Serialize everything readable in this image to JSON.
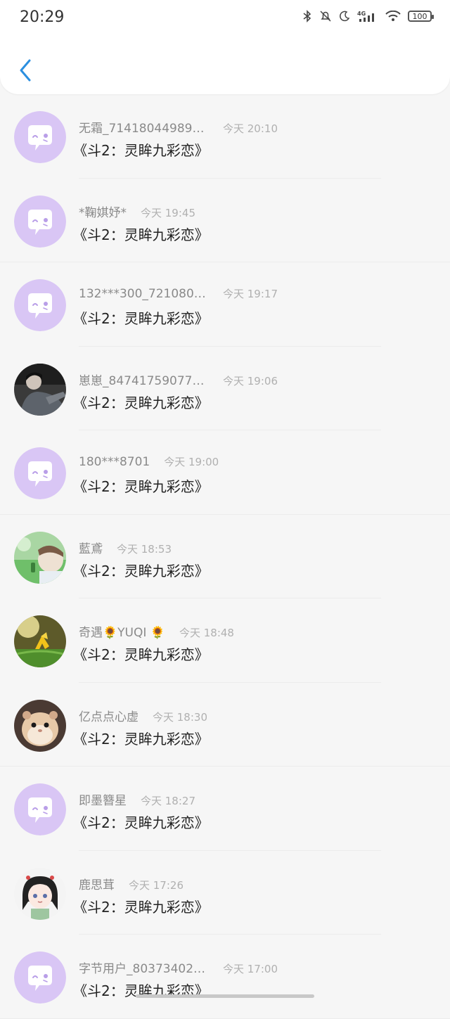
{
  "status": {
    "time": "20:29",
    "network": "4G",
    "battery": "100"
  },
  "colors": {
    "accent": "#2b8fe0",
    "default_avatar_bg": "#d9c6f5",
    "default_avatar_icon": "#ffffff"
  },
  "messages": [
    {
      "name": "无霜_714180449898…",
      "time": "今天 20:10",
      "text": "《斗2：灵眸九彩恋》",
      "avatar": "default"
    },
    {
      "name": "*鞠娸妤*",
      "time": "今天 19:45",
      "text": "《斗2：灵眸九彩恋》",
      "avatar": "default"
    },
    {
      "name": "132***300_721080624",
      "time": "今天 19:17",
      "text": "《斗2：灵眸九彩恋》",
      "avatar": "default"
    },
    {
      "name": "崽崽_847417590773…",
      "time": "今天 19:06",
      "text": "《斗2：灵眸九彩恋》",
      "avatar": "photo-dark"
    },
    {
      "name": "180***8701",
      "time": "今天 19:00",
      "text": "《斗2：灵眸九彩恋》",
      "avatar": "default"
    },
    {
      "name": "藍鳶",
      "time": "今天 18:53",
      "text": "《斗2：灵眸九彩恋》",
      "avatar": "photo-green"
    },
    {
      "name": "奇遇🌻YUQI 🌻",
      "time": "今天 18:48",
      "text": "《斗2：灵眸九彩恋》",
      "avatar": "photo-flower"
    },
    {
      "name": "亿点点心虚",
      "time": "今天 18:30",
      "text": "《斗2：灵眸九彩恋》",
      "avatar": "photo-hamster"
    },
    {
      "name": "即墨簪星",
      "time": "今天 18:27",
      "text": "《斗2：灵眸九彩恋》",
      "avatar": "default"
    },
    {
      "name": "鹿思茸",
      "time": "今天 17:26",
      "text": "《斗2：灵眸九彩恋》",
      "avatar": "photo-anime"
    },
    {
      "name": "字节用户_803734024…",
      "time": "今天 17:00",
      "text": "《斗2：灵眸九彩恋》",
      "avatar": "default"
    }
  ]
}
